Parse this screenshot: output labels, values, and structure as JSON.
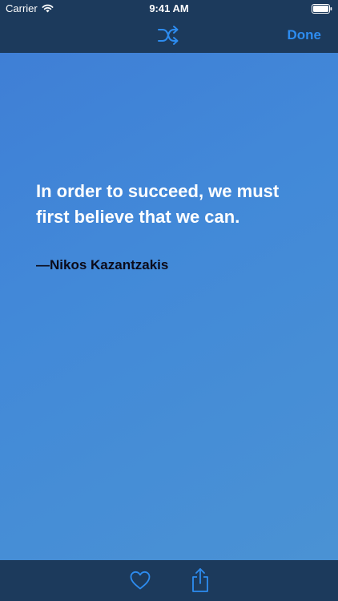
{
  "status_bar": {
    "carrier": "Carrier",
    "time": "9:41 AM",
    "wifi_icon": "wifi-icon",
    "battery_icon": "battery-icon"
  },
  "nav_bar": {
    "shuffle_icon": "shuffle-icon",
    "done_label": "Done"
  },
  "quote": {
    "text": "In order to succeed, we must first believe that we can.",
    "author": "—Nikos Kazantzakis"
  },
  "toolbar": {
    "favorite_icon": "heart-icon",
    "share_icon": "share-icon"
  },
  "colors": {
    "bar_background": "#1c3a5c",
    "accent": "#2d8cf0",
    "quote_background": "#4289d8",
    "quote_text": "#ffffff",
    "author_text": "#0b0b1a"
  }
}
